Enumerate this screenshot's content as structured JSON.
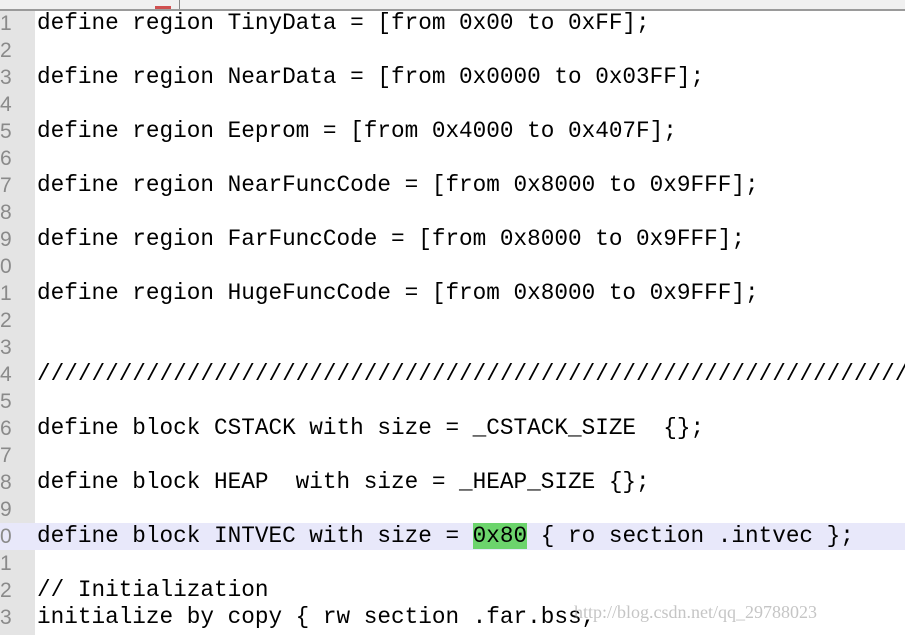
{
  "colors": {
    "gutter": "#e4e4e4",
    "current_line": "#e8e8fa",
    "match_highlight": "#6cd46c"
  },
  "editor": {
    "current_line_index": 19,
    "highlight": {
      "line_index": 19,
      "before": "define block INTVEC with size = ",
      "match": "0x80",
      "after": " { ro section .intvec };"
    },
    "lines": [
      {
        "num": "1",
        "text": "define region TinyData = [from 0x00 to 0xFF];"
      },
      {
        "num": "2",
        "text": ""
      },
      {
        "num": "3",
        "text": "define region NearData = [from 0x0000 to 0x03FF];"
      },
      {
        "num": "4",
        "text": ""
      },
      {
        "num": "5",
        "text": "define region Eeprom = [from 0x4000 to 0x407F];"
      },
      {
        "num": "6",
        "text": ""
      },
      {
        "num": "7",
        "text": "define region NearFuncCode = [from 0x8000 to 0x9FFF];"
      },
      {
        "num": "8",
        "text": ""
      },
      {
        "num": "9",
        "text": "define region FarFuncCode = [from 0x8000 to 0x9FFF];"
      },
      {
        "num": "0",
        "text": ""
      },
      {
        "num": "1",
        "text": "define region HugeFuncCode = [from 0x8000 to 0x9FFF];"
      },
      {
        "num": "2",
        "text": ""
      },
      {
        "num": "3",
        "text": ""
      },
      {
        "num": "4",
        "text": "//////////////////////////////////////////////////////////////////"
      },
      {
        "num": "5",
        "text": ""
      },
      {
        "num": "6",
        "text": "define block CSTACK with size = _CSTACK_SIZE  {};"
      },
      {
        "num": "7",
        "text": ""
      },
      {
        "num": "8",
        "text": "define block HEAP  with size = _HEAP_SIZE {};"
      },
      {
        "num": "9",
        "text": ""
      },
      {
        "num": "0",
        "text": ""
      },
      {
        "num": "1",
        "text": ""
      },
      {
        "num": "2",
        "text": "// Initialization"
      },
      {
        "num": "3",
        "text": "initialize by copy { rw section .far.bss,"
      }
    ]
  },
  "watermark": "http://blog.csdn.net/qq_29788023"
}
